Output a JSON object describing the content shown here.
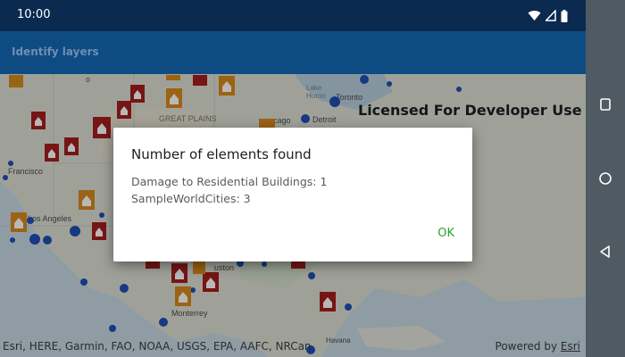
{
  "status_bar": {
    "time": "10:00",
    "icons": [
      "wifi-icon",
      "signal-icon",
      "battery-icon"
    ]
  },
  "app_bar": {
    "title": "Identify layers"
  },
  "map": {
    "watermark": "Licensed For Developer Use Only",
    "labels": {
      "great_plains": "GREAT PLAINS",
      "francisco": "Francisco",
      "los_angeles": "Los Angeles",
      "lake_huron": "Lake\nHuron",
      "toronto": "Toronto",
      "detroit": "Detroit",
      "chicago": "cago",
      "houston": "uston",
      "monterrey": "Monterrey",
      "havana": "Havana",
      "o": "o"
    },
    "attribution": "Esri, HERE, Garmin, FAO, NOAA, USGS, EPA, AAFC, NRCan",
    "powered_by_prefix": "Powered by ",
    "powered_by_link": "Esri"
  },
  "dialog": {
    "title": "Number of elements found",
    "lines": [
      "Damage to Residential Buildings: 1",
      "SampleWorldCities: 3"
    ],
    "ok_label": "OK"
  },
  "nav": {
    "buttons": [
      "recents-icon",
      "home-icon",
      "back-icon"
    ]
  },
  "colors": {
    "status_bar": "#0b2a50",
    "app_bar": "#0e4b83",
    "accent": "#2aa02a",
    "marker_red": "#a51e1e",
    "marker_orange": "#d78a1c",
    "city_dot": "#1f4fb3"
  }
}
